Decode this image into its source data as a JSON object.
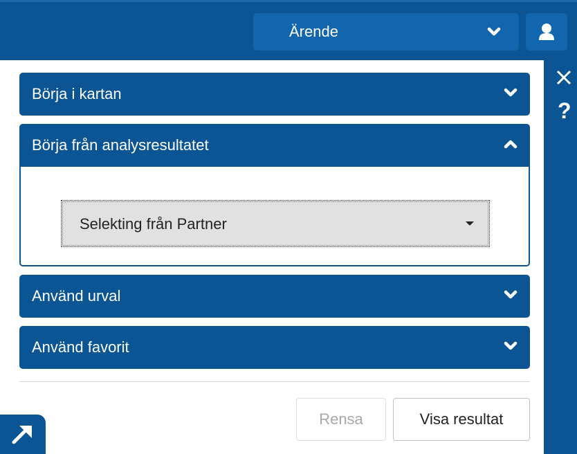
{
  "header": {
    "case_select": {
      "label": "Ärende"
    }
  },
  "sidebar_tools": {
    "close_icon": "close-icon",
    "help_glyph": "?"
  },
  "accordion": {
    "items": [
      {
        "label": "Börja i kartan",
        "expanded": false
      },
      {
        "label": "Börja från analysresultatet",
        "expanded": true
      },
      {
        "label": "Använd urval",
        "expanded": false
      },
      {
        "label": "Använd favorit",
        "expanded": false
      }
    ],
    "analysis_select": {
      "value": "Selekting från Partner"
    }
  },
  "actions": {
    "clear_label": "Rensa",
    "show_label": "Visa resultat"
  },
  "colors": {
    "primary": "#0c5595",
    "primary_light": "#1266ad",
    "select_bg": "#e1e1e1"
  }
}
